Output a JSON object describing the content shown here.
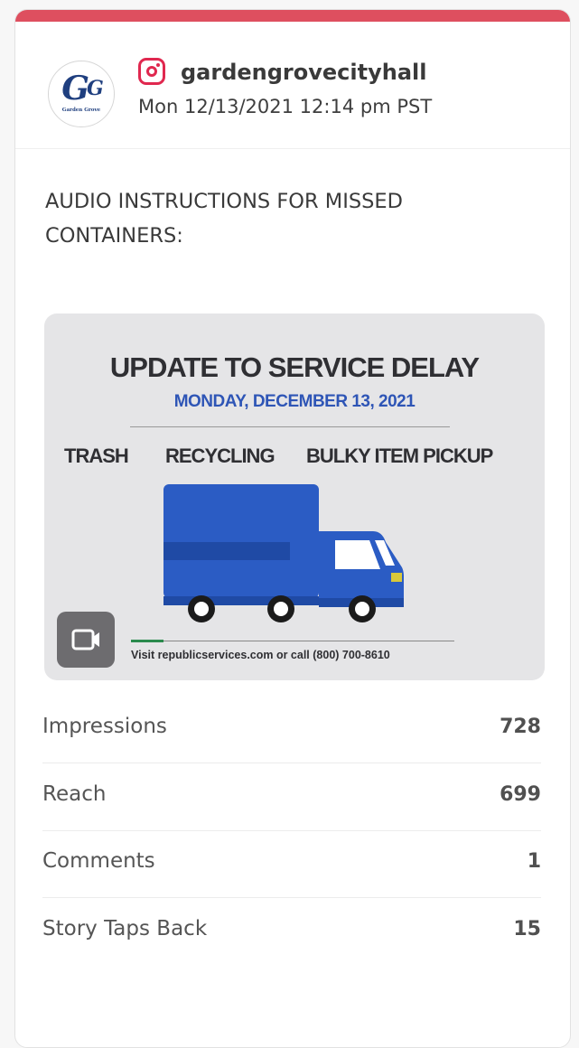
{
  "post": {
    "avatar": {
      "logo_text": "G",
      "logo_sub": "G",
      "logo_caption": "Garden Grove"
    },
    "platform_icon": "instagram-icon",
    "account": "gardengrovecityhall",
    "datetime": "Mon 12/13/2021 12:14 pm PST",
    "caption": "AUDIO INSTRUCTIONS FOR MISSED CONTAINERS:"
  },
  "media": {
    "headline": "UPDATE TO SERVICE DELAY",
    "date": "MONDAY, DECEMBER 13, 2021",
    "services": [
      "TRASH",
      "RECYCLING",
      "BULKY ITEM PICKUP"
    ],
    "footer": "Visit republicservices.com or call (800) 700-8610",
    "type_icon": "video-camera-icon"
  },
  "metrics": [
    {
      "label": "Impressions",
      "value": "728"
    },
    {
      "label": "Reach",
      "value": "699"
    },
    {
      "label": "Comments",
      "value": "1"
    },
    {
      "label": "Story Taps Back",
      "value": "15"
    }
  ],
  "colors": {
    "accent_bar": "#de4f5f",
    "instagram": "#e0284f",
    "date_blue": "#2e55b6",
    "truck_blue": "#2b5cc4"
  }
}
